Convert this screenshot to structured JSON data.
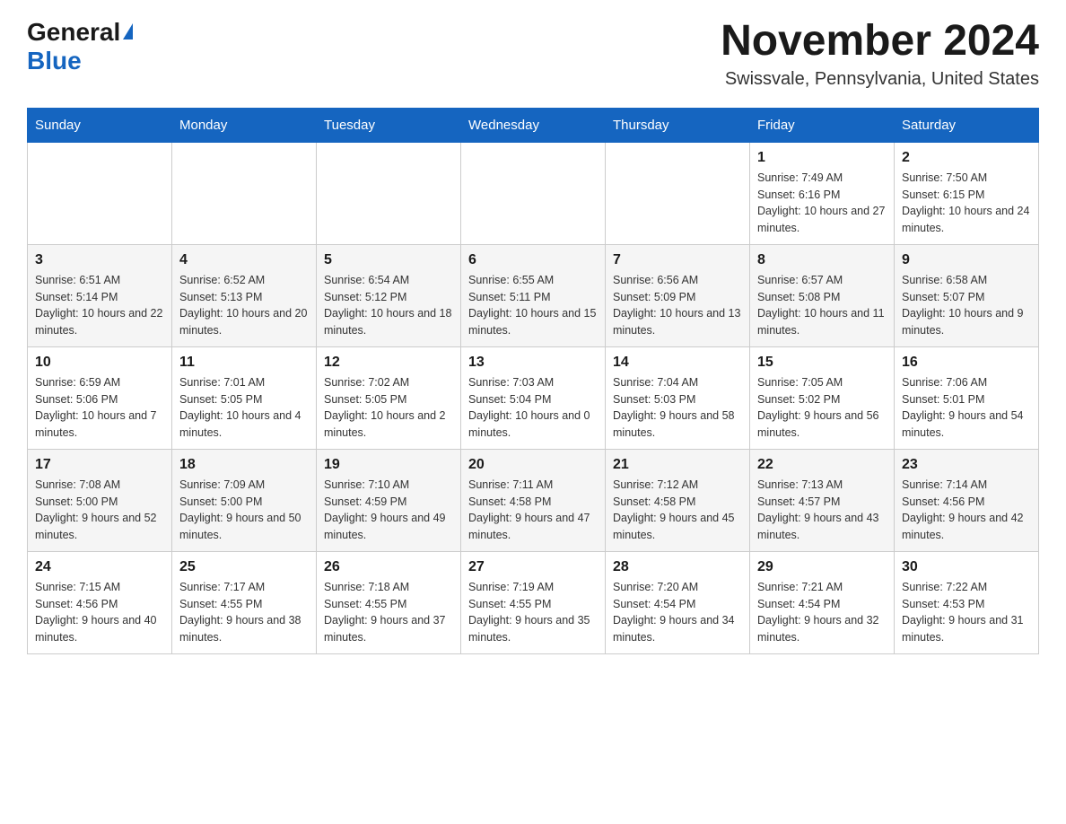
{
  "header": {
    "logo_general": "General",
    "logo_blue": "Blue",
    "month_year": "November 2024",
    "location": "Swissvale, Pennsylvania, United States"
  },
  "days_of_week": [
    "Sunday",
    "Monday",
    "Tuesday",
    "Wednesday",
    "Thursday",
    "Friday",
    "Saturday"
  ],
  "weeks": [
    [
      {
        "day": "",
        "info": ""
      },
      {
        "day": "",
        "info": ""
      },
      {
        "day": "",
        "info": ""
      },
      {
        "day": "",
        "info": ""
      },
      {
        "day": "",
        "info": ""
      },
      {
        "day": "1",
        "info": "Sunrise: 7:49 AM\nSunset: 6:16 PM\nDaylight: 10 hours and 27 minutes."
      },
      {
        "day": "2",
        "info": "Sunrise: 7:50 AM\nSunset: 6:15 PM\nDaylight: 10 hours and 24 minutes."
      }
    ],
    [
      {
        "day": "3",
        "info": "Sunrise: 6:51 AM\nSunset: 5:14 PM\nDaylight: 10 hours and 22 minutes."
      },
      {
        "day": "4",
        "info": "Sunrise: 6:52 AM\nSunset: 5:13 PM\nDaylight: 10 hours and 20 minutes."
      },
      {
        "day": "5",
        "info": "Sunrise: 6:54 AM\nSunset: 5:12 PM\nDaylight: 10 hours and 18 minutes."
      },
      {
        "day": "6",
        "info": "Sunrise: 6:55 AM\nSunset: 5:11 PM\nDaylight: 10 hours and 15 minutes."
      },
      {
        "day": "7",
        "info": "Sunrise: 6:56 AM\nSunset: 5:09 PM\nDaylight: 10 hours and 13 minutes."
      },
      {
        "day": "8",
        "info": "Sunrise: 6:57 AM\nSunset: 5:08 PM\nDaylight: 10 hours and 11 minutes."
      },
      {
        "day": "9",
        "info": "Sunrise: 6:58 AM\nSunset: 5:07 PM\nDaylight: 10 hours and 9 minutes."
      }
    ],
    [
      {
        "day": "10",
        "info": "Sunrise: 6:59 AM\nSunset: 5:06 PM\nDaylight: 10 hours and 7 minutes."
      },
      {
        "day": "11",
        "info": "Sunrise: 7:01 AM\nSunset: 5:05 PM\nDaylight: 10 hours and 4 minutes."
      },
      {
        "day": "12",
        "info": "Sunrise: 7:02 AM\nSunset: 5:05 PM\nDaylight: 10 hours and 2 minutes."
      },
      {
        "day": "13",
        "info": "Sunrise: 7:03 AM\nSunset: 5:04 PM\nDaylight: 10 hours and 0 minutes."
      },
      {
        "day": "14",
        "info": "Sunrise: 7:04 AM\nSunset: 5:03 PM\nDaylight: 9 hours and 58 minutes."
      },
      {
        "day": "15",
        "info": "Sunrise: 7:05 AM\nSunset: 5:02 PM\nDaylight: 9 hours and 56 minutes."
      },
      {
        "day": "16",
        "info": "Sunrise: 7:06 AM\nSunset: 5:01 PM\nDaylight: 9 hours and 54 minutes."
      }
    ],
    [
      {
        "day": "17",
        "info": "Sunrise: 7:08 AM\nSunset: 5:00 PM\nDaylight: 9 hours and 52 minutes."
      },
      {
        "day": "18",
        "info": "Sunrise: 7:09 AM\nSunset: 5:00 PM\nDaylight: 9 hours and 50 minutes."
      },
      {
        "day": "19",
        "info": "Sunrise: 7:10 AM\nSunset: 4:59 PM\nDaylight: 9 hours and 49 minutes."
      },
      {
        "day": "20",
        "info": "Sunrise: 7:11 AM\nSunset: 4:58 PM\nDaylight: 9 hours and 47 minutes."
      },
      {
        "day": "21",
        "info": "Sunrise: 7:12 AM\nSunset: 4:58 PM\nDaylight: 9 hours and 45 minutes."
      },
      {
        "day": "22",
        "info": "Sunrise: 7:13 AM\nSunset: 4:57 PM\nDaylight: 9 hours and 43 minutes."
      },
      {
        "day": "23",
        "info": "Sunrise: 7:14 AM\nSunset: 4:56 PM\nDaylight: 9 hours and 42 minutes."
      }
    ],
    [
      {
        "day": "24",
        "info": "Sunrise: 7:15 AM\nSunset: 4:56 PM\nDaylight: 9 hours and 40 minutes."
      },
      {
        "day": "25",
        "info": "Sunrise: 7:17 AM\nSunset: 4:55 PM\nDaylight: 9 hours and 38 minutes."
      },
      {
        "day": "26",
        "info": "Sunrise: 7:18 AM\nSunset: 4:55 PM\nDaylight: 9 hours and 37 minutes."
      },
      {
        "day": "27",
        "info": "Sunrise: 7:19 AM\nSunset: 4:55 PM\nDaylight: 9 hours and 35 minutes."
      },
      {
        "day": "28",
        "info": "Sunrise: 7:20 AM\nSunset: 4:54 PM\nDaylight: 9 hours and 34 minutes."
      },
      {
        "day": "29",
        "info": "Sunrise: 7:21 AM\nSunset: 4:54 PM\nDaylight: 9 hours and 32 minutes."
      },
      {
        "day": "30",
        "info": "Sunrise: 7:22 AM\nSunset: 4:53 PM\nDaylight: 9 hours and 31 minutes."
      }
    ]
  ]
}
